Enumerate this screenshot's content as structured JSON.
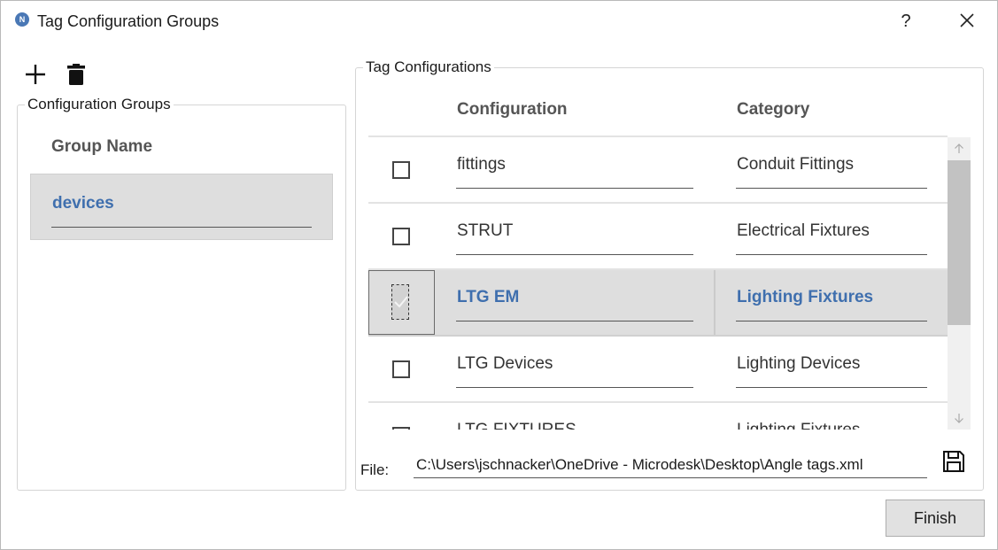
{
  "window": {
    "title": "Tag Configuration Groups",
    "app_icon_letter": "N",
    "help_label": "?"
  },
  "groups_panel": {
    "legend": "Configuration Groups",
    "column_header": "Group Name",
    "selected_group": "devices"
  },
  "configs_panel": {
    "legend": "Tag Configurations",
    "columns": [
      "Configuration",
      "Category"
    ],
    "rows": [
      {
        "configuration": "fittings",
        "category": "Conduit Fittings",
        "checked": false,
        "selected": false
      },
      {
        "configuration": "STRUT",
        "category": "Electrical Fixtures",
        "checked": false,
        "selected": false
      },
      {
        "configuration": "LTG EM",
        "category": "Lighting Fixtures",
        "checked": true,
        "selected": true
      },
      {
        "configuration": "LTG Devices",
        "category": "Lighting Devices",
        "checked": false,
        "selected": false
      },
      {
        "configuration": "LTG FIXTURES",
        "category": "Lighting Fixtures",
        "checked": false,
        "selected": false
      }
    ],
    "file_label": "File:",
    "file_path": "C:\\Users\\jschnacker\\OneDrive - Microdesk\\Desktop\\Angle tags.xml"
  },
  "footer": {
    "finish_label": "Finish"
  },
  "icons": {
    "app": "n-logo-icon",
    "help": "help-icon",
    "close": "close-icon",
    "add": "plus-icon",
    "delete": "trash-icon",
    "save": "floppy-disk-icon",
    "scroll_up": "arrow-up-icon",
    "scroll_down": "arrow-down-icon"
  },
  "colors": {
    "accent_text": "#3f6fae",
    "selected_row_bg": "#dedede",
    "header_text": "#555555"
  }
}
